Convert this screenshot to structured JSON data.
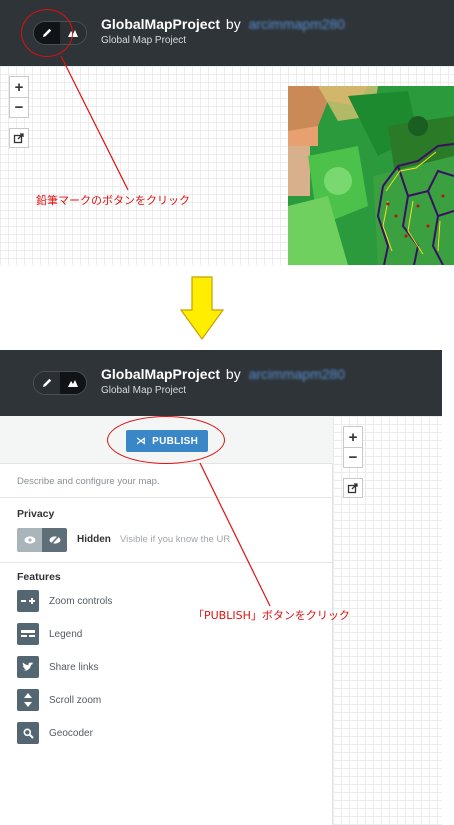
{
  "panel1": {
    "project_title": "GlobalMapProject",
    "by_text": "by",
    "username": "arcimmapm280",
    "subtitle": "Global Map Project",
    "zoom_in": "+",
    "zoom_out": "−",
    "annotation": "鉛筆マークのボタンをクリック"
  },
  "panel2": {
    "project_title": "GlobalMapProject",
    "by_text": "by",
    "username": "arcimmapm280",
    "subtitle": "Global Map Project",
    "publish_label": "PUBLISH",
    "description": "Describe and configure your map.",
    "privacy_title": "Privacy",
    "privacy_state": "Hidden",
    "privacy_desc": "Visible if you know the UR",
    "features_title": "Features",
    "features": [
      {
        "label": "Zoom controls",
        "icon": "zoom-controls-icon"
      },
      {
        "label": "Legend",
        "icon": "legend-icon"
      },
      {
        "label": "Share links",
        "icon": "twitter-icon"
      },
      {
        "label": "Scroll zoom",
        "icon": "scroll-zoom-icon"
      },
      {
        "label": "Geocoder",
        "icon": "search-icon"
      }
    ],
    "zoom_in": "+",
    "zoom_out": "−",
    "annotation": "「PUBLISH」ボタンをクリック"
  },
  "colors": {
    "header_bg": "#2e3438",
    "publish_button": "#3a87c8",
    "annotation_red": "#e01010",
    "arrow_yellow": "#ffee00",
    "feature_icon_bg": "#546672"
  }
}
